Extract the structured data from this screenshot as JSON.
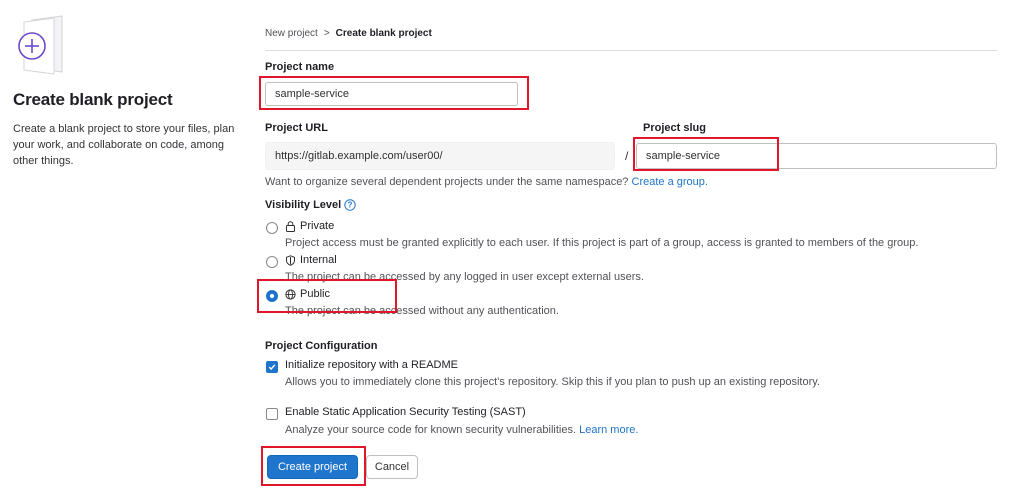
{
  "sidebar": {
    "title": "Create blank project",
    "description": "Create a blank project to store your files, plan your work, and collaborate on code, among other things."
  },
  "breadcrumb": {
    "items": [
      "New project",
      "Create blank project"
    ],
    "separator": ">"
  },
  "form": {
    "project_name": {
      "label": "Project name",
      "value": "sample-service"
    },
    "project_url": {
      "label": "Project URL",
      "value": "https://gitlab.example.com/user00/",
      "separator": "/"
    },
    "project_slug": {
      "label": "Project slug",
      "value": "sample-service"
    },
    "namespace_help": {
      "text": "Want to organize several dependent projects under the same namespace?",
      "link": "Create a group."
    },
    "visibility": {
      "label": "Visibility Level",
      "options": [
        {
          "label": "Private",
          "icon": "lock-icon",
          "description": "Project access must be granted explicitly to each user. If this project is part of a group, access is granted to members of the group.",
          "selected": false
        },
        {
          "label": "Internal",
          "icon": "shield-icon",
          "description": "The project can be accessed by any logged in user except external users.",
          "selected": false
        },
        {
          "label": "Public",
          "icon": "globe-icon",
          "description": "The project can be accessed without any authentication.",
          "selected": true
        }
      ]
    },
    "configuration": {
      "label": "Project Configuration",
      "options": [
        {
          "label": "Initialize repository with a README",
          "description": "Allows you to immediately clone this project’s repository. Skip this if you plan to push up an existing repository.",
          "checked": true
        },
        {
          "label": "Enable Static Application Security Testing (SAST)",
          "description": "Analyze your source code for known security vulnerabilities.",
          "link": "Learn more.",
          "checked": false
        }
      ]
    }
  },
  "actions": {
    "create_label": "Create project",
    "cancel_label": "Cancel"
  },
  "colors": {
    "primary": "#1f75cb",
    "highlight": "#e0162b",
    "illustration": "#6e49cb"
  }
}
